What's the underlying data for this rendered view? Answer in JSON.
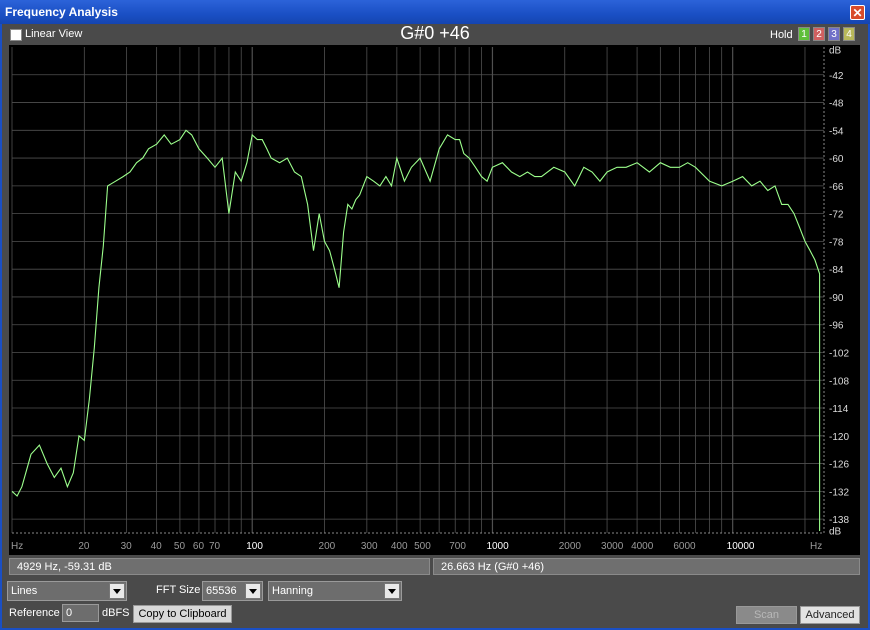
{
  "window": {
    "title": "Frequency Analysis",
    "close_glyph": "✕"
  },
  "toolbar": {
    "linear_view_label": "Linear View",
    "linear_view_checked": false,
    "note": "G#0 +46",
    "hold_label": "Hold"
  },
  "hold_buttons": [
    {
      "label": "1",
      "color": "#5fbf3a"
    },
    {
      "label": "2",
      "color": "#d06060"
    },
    {
      "label": "3",
      "color": "#7070c8"
    },
    {
      "label": "4",
      "color": "#b8b85a"
    }
  ],
  "chart_data": {
    "type": "line",
    "xlabel": "Hz",
    "ylabel": "dB",
    "x_scale": "log",
    "xlim": [
      10,
      24000
    ],
    "ylim": [
      -141,
      -36
    ],
    "line_color": "#9cff8c",
    "grid": true,
    "x_tick_labels": [
      "Hz",
      "20",
      "30",
      "40",
      "50",
      "60",
      "70",
      "100",
      "200",
      "300",
      "400",
      "500",
      "700",
      "1000",
      "2000",
      "3000",
      "4000",
      "6000",
      "10000",
      "Hz"
    ],
    "y_tick_labels": [
      "dB",
      "-42",
      "-48",
      "-54",
      "-60",
      "-66",
      "-72",
      "-78",
      "-84",
      "-90",
      "-96",
      "-102",
      "-108",
      "-114",
      "-120",
      "-126",
      "-132",
      "-138",
      "dB"
    ],
    "series": [
      {
        "x": [
          10,
          10.5,
          11,
          12,
          13,
          14,
          15,
          16,
          17,
          18,
          19,
          20,
          21,
          22,
          23,
          24,
          25,
          27,
          29,
          31,
          33,
          35,
          37,
          40,
          43,
          46,
          50,
          53,
          56,
          60,
          65,
          70,
          75,
          80,
          85,
          90,
          95,
          100,
          105,
          110,
          115,
          120,
          130,
          140,
          150,
          160,
          170,
          180,
          190,
          200,
          210,
          220,
          230,
          240,
          250,
          260,
          270,
          280,
          300,
          320,
          340,
          360,
          380,
          400,
          430,
          460,
          500,
          550,
          600,
          650,
          700,
          730,
          760,
          800,
          850,
          900,
          950,
          1000,
          1100,
          1200,
          1300,
          1400,
          1500,
          1600,
          1800,
          2000,
          2200,
          2400,
          2600,
          2800,
          3000,
          3300,
          3600,
          4000,
          4500,
          5000,
          5500,
          6000,
          6500,
          7000,
          8000,
          9000,
          10000,
          11000,
          12000,
          13000,
          14000,
          15000,
          16000,
          17000,
          18000,
          19000,
          20000,
          21000,
          22000,
          23000
        ],
        "y": [
          -132,
          -133,
          -131,
          -124,
          -122,
          -126,
          -129,
          -127,
          -131,
          -128,
          -120,
          -121,
          -112,
          -101,
          -88,
          -79,
          -66,
          -65,
          -64,
          -63,
          -61,
          -60,
          -58,
          -57,
          -55,
          -57,
          -56,
          -54,
          -55,
          -58,
          -60,
          -62,
          -60,
          -72,
          -63,
          -65,
          -61,
          -55,
          -56,
          -56,
          -58,
          -60,
          -61,
          -60,
          -63,
          -64,
          -70,
          -80,
          -72,
          -78,
          -80,
          -84,
          -88,
          -76,
          -70,
          -71,
          -69,
          -68,
          -64,
          -65,
          -66,
          -64,
          -66,
          -60,
          -65,
          -62,
          -60,
          -65,
          -58,
          -55,
          -56,
          -56,
          -59,
          -60,
          -62,
          -64,
          -65,
          -62,
          -61,
          -63,
          -64,
          -63,
          -64,
          -64,
          -62,
          -63,
          -66,
          -62,
          -63,
          -65,
          -63,
          -62,
          -62,
          -61,
          -63,
          -61,
          -62,
          -62,
          -61,
          -62,
          -65,
          -66,
          -65,
          -64,
          -66,
          -65,
          -67,
          -66,
          -70,
          -70,
          -72,
          -75,
          -78,
          -80,
          -82,
          -85
        ]
      }
    ]
  },
  "status": {
    "cursor_readout": "4929 Hz, -59.31 dB",
    "peak_readout": "26.663 Hz (G#0 +46)"
  },
  "controls": {
    "display_mode": "Lines",
    "fft_size_label": "FFT Size",
    "fft_size": "65536",
    "window_function": "Hanning",
    "reference_label": "Reference",
    "reference_value": "0",
    "reference_unit": "dBFS",
    "copy_button": "Copy to Clipboard",
    "scan_button": "Scan",
    "advanced_button": "Advanced"
  }
}
